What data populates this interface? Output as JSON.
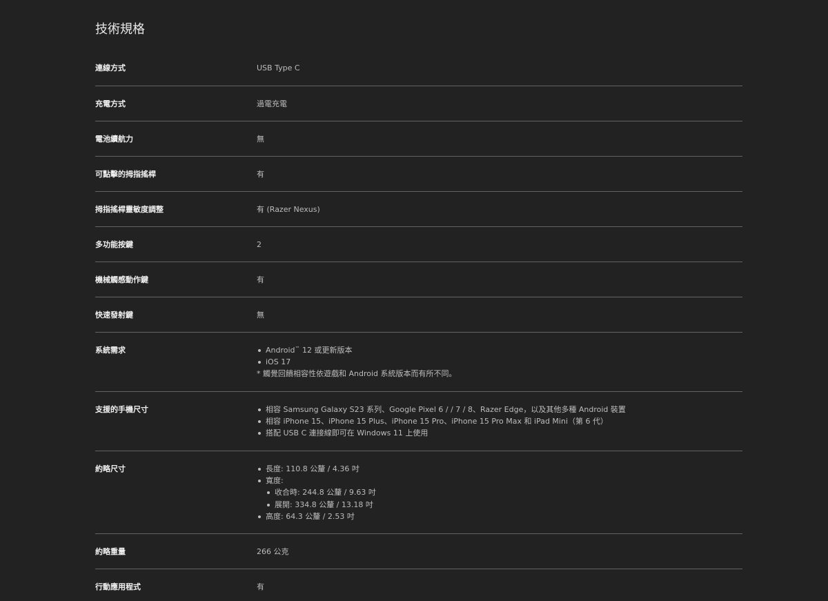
{
  "page": {
    "title": "技術規格"
  },
  "specs": {
    "connection": {
      "label": "連線方式",
      "value": "USB Type C"
    },
    "charging": {
      "label": "充電方式",
      "value": "過電充電"
    },
    "battery": {
      "label": "電池續航力",
      "value": "無"
    },
    "clickable_sticks": {
      "label": "可點擊的拇指搖桿",
      "value": "有"
    },
    "stick_sensitivity": {
      "label": "拇指搖桿靈敏度調整",
      "value": "有 (Razer Nexus)"
    },
    "multifunction_buttons": {
      "label": "多功能按鍵",
      "value": "2"
    },
    "mecha_tactile": {
      "label": "機械觸感動作鍵",
      "value": "有"
    },
    "rapid_fire": {
      "label": "快速發射鍵",
      "value": "無"
    },
    "system_requirements": {
      "label": "系統需求",
      "items": [
        "Android",
        "iOS 17"
      ],
      "android_tm": "™",
      "android_suffix": " 12 或更新版本",
      "note": "* 觸覺回饋相容性依遊戲和 Android 系統版本而有所不同。"
    },
    "supported_phones": {
      "label": "支援的手機尺寸",
      "items": [
        "相容 Samsung Galaxy S23 系列、Google Pixel 6 / / 7 / 8、Razer Edge，以及其他多種 Android 裝置",
        "相容 iPhone 15、iPhone 15 Plus、iPhone 15 Pro、iPhone 15 Pro Max 和 iPad Mini（第 6 代）",
        "搭配 USB C 連接線即可在 Windows 11 上使用"
      ]
    },
    "dimensions": {
      "label": "約略尺寸",
      "length": "長度: 110.8 公釐 / 4.36 吋",
      "width": "寬度:",
      "width_items": [
        "收合時: 244.8 公釐 / 9.63 吋",
        "展開: 334.8 公釐 / 13.18 吋"
      ],
      "height": "高度: 64.3 公釐 / 2.53 吋"
    },
    "weight": {
      "label": "約略重量",
      "value": "266 公克"
    },
    "mobile_app": {
      "label": "行動應用程式",
      "value": "有"
    }
  }
}
